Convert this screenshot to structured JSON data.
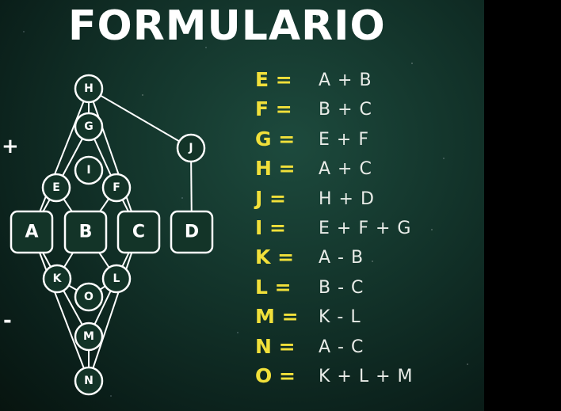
{
  "title": "FORMULARIO",
  "signs": {
    "plus": "+",
    "minus": "-"
  },
  "diagram": {
    "nodes": [
      {
        "id": "H",
        "label": "H",
        "shape": "circle"
      },
      {
        "id": "G",
        "label": "G",
        "shape": "circle"
      },
      {
        "id": "J",
        "label": "J",
        "shape": "circle"
      },
      {
        "id": "I",
        "label": "I",
        "shape": "circle"
      },
      {
        "id": "E",
        "label": "E",
        "shape": "circle"
      },
      {
        "id": "F",
        "label": "F",
        "shape": "circle"
      },
      {
        "id": "A",
        "label": "A",
        "shape": "square"
      },
      {
        "id": "B",
        "label": "B",
        "shape": "square"
      },
      {
        "id": "C",
        "label": "C",
        "shape": "square"
      },
      {
        "id": "D",
        "label": "D",
        "shape": "square"
      },
      {
        "id": "K",
        "label": "K",
        "shape": "circle"
      },
      {
        "id": "L",
        "label": "L",
        "shape": "circle"
      },
      {
        "id": "O",
        "label": "O",
        "shape": "circle"
      },
      {
        "id": "M",
        "label": "M",
        "shape": "circle"
      },
      {
        "id": "N",
        "label": "N",
        "shape": "circle"
      }
    ],
    "edges": [
      [
        "H",
        "J"
      ],
      [
        "J",
        "D"
      ],
      [
        "H",
        "A"
      ],
      [
        "H",
        "C"
      ],
      [
        "H",
        "G"
      ],
      [
        "G",
        "E"
      ],
      [
        "G",
        "F"
      ],
      [
        "E",
        "A"
      ],
      [
        "E",
        "B"
      ],
      [
        "F",
        "B"
      ],
      [
        "F",
        "C"
      ],
      [
        "A",
        "N"
      ],
      [
        "C",
        "N"
      ],
      [
        "A",
        "K"
      ],
      [
        "B",
        "K"
      ],
      [
        "B",
        "L"
      ],
      [
        "C",
        "L"
      ],
      [
        "K",
        "O"
      ],
      [
        "L",
        "O"
      ],
      [
        "K",
        "M"
      ],
      [
        "L",
        "M"
      ],
      [
        "M",
        "N"
      ]
    ]
  },
  "formulas": [
    {
      "lhs": "E =",
      "rhs": "A + B"
    },
    {
      "lhs": "F =",
      "rhs": "B + C"
    },
    {
      "lhs": "G =",
      "rhs": "E + F"
    },
    {
      "lhs": "H =",
      "rhs": "A + C"
    },
    {
      "lhs": "J =",
      "rhs": "H + D"
    },
    {
      "lhs": "I =",
      "rhs": "E + F + G"
    },
    {
      "lhs": "K =",
      "rhs": "A - B"
    },
    {
      "lhs": "L =",
      "rhs": "B - C"
    },
    {
      "lhs": "M =",
      "rhs": "K - L"
    },
    {
      "lhs": "N =",
      "rhs": "A - C"
    },
    {
      "lhs": "O =",
      "rhs": "K + L + M"
    }
  ],
  "colors": {
    "formula_lhs": "#f1e03a",
    "formula_rhs": "#e9ece8",
    "node_stroke": "#ffffff",
    "background": "#123229"
  }
}
